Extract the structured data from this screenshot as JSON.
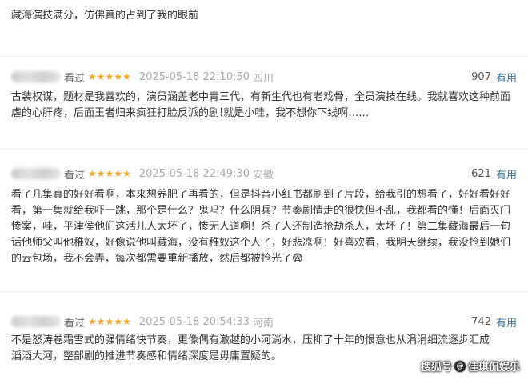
{
  "top_snippet": "藏海演技满分，仿佛真的占到了我的眼前",
  "reviews": [
    {
      "status": "看过",
      "stars": "★★★★★",
      "date": "2025-05-18 22:10:50",
      "location": "四川",
      "votes": "907",
      "useful_label": "有用",
      "content": "古装权谋，题材是我喜欢的，演员涵盖老中青三代，有新生代也有老戏骨，全员演技在线。我就喜欢这种前面虐的心肝疼，后面王者归来疯狂打脸反派的剧!就是小哇，我不想你下线啊……"
    },
    {
      "status": "看过",
      "stars": "★★★★★",
      "date": "2025-05-18 22:49:30",
      "location": "安徽",
      "votes": "621",
      "useful_label": "有用",
      "content": "看了几集真的好好看啊，本来想养肥了再看的，但是抖音小红书都刷到了片段，给我引的想看了，好好看好好看，第一集就给我吓一跳，那个是什么？鬼吗？什么阴兵？节奏剧情走的很快但不乱，我都看的懂！后面灭门惨案，哇，平津侯他们这活儿人太坏了，惨无人道啊！杀了人还制造抢劫杀人，太坏了！第二集藏海最后一句话他师父叫他稚奴，好像说他叫藏海，没有稚奴这个人了，好悲凉啊！好喜欢看，我明天继续，我没抢到她们的云包场，我不会弄，每次都需要重新播放，然后都被抢光了😨"
    },
    {
      "status": "看过",
      "stars": "★★★★★",
      "date": "2025-05-18 20:54:33",
      "location": "河南",
      "votes": "742",
      "useful_label": "有用",
      "content": "不是怒涛卷霜雪式的强情绪快节奏，更像偶有激越的小河淌水，压抑了十年的恨意也从涓涓细流逐步汇成滔滔大河，整部剧的推进节奏感和情绪深度是毋庸置疑的。"
    }
  ],
  "watermark": {
    "prefix": "搜狐号",
    "at": "@",
    "name": "佳琪侃娱乐"
  }
}
